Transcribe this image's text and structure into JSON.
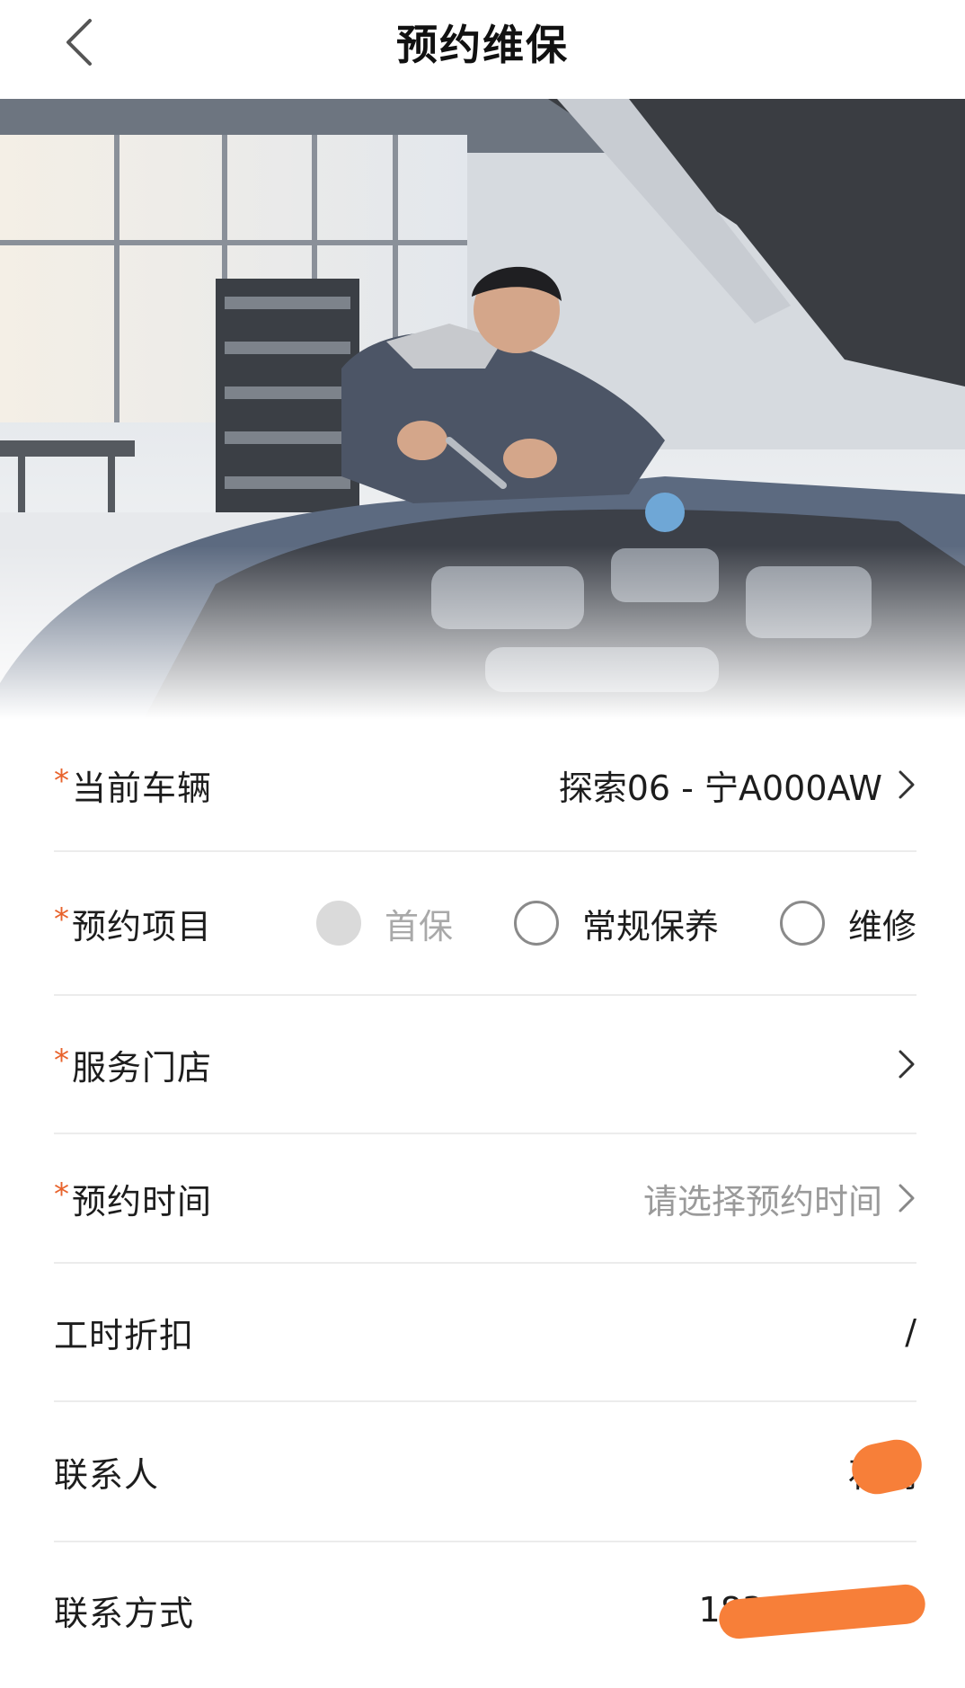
{
  "header": {
    "title": "预约维保"
  },
  "form": {
    "vehicle": {
      "label": "当前车辆",
      "required_mark": "*",
      "value": "探索06 - 宁A000AW"
    },
    "project": {
      "label": "预约项目",
      "required_mark": "*",
      "options": [
        {
          "label": "首保",
          "state": "disabled"
        },
        {
          "label": "常规保养",
          "state": "unselected"
        },
        {
          "label": "维修",
          "state": "unselected"
        }
      ]
    },
    "store": {
      "label": "服务门店",
      "required_mark": "*",
      "value": ""
    },
    "time": {
      "label": "预约时间",
      "required_mark": "*",
      "placeholder": "请选择预约时间"
    },
    "discount": {
      "label": "工时折扣",
      "value": "/"
    },
    "contact_person": {
      "label": "联系人",
      "value": "石明"
    },
    "contact_method": {
      "label": "联系方式",
      "value": "183"
    }
  },
  "colors": {
    "required": "#e8632c",
    "redaction": "#f77f39",
    "divider": "#ececec"
  },
  "icons": {
    "back": "chevron-left-icon",
    "disclosure": "chevron-right-icon"
  }
}
